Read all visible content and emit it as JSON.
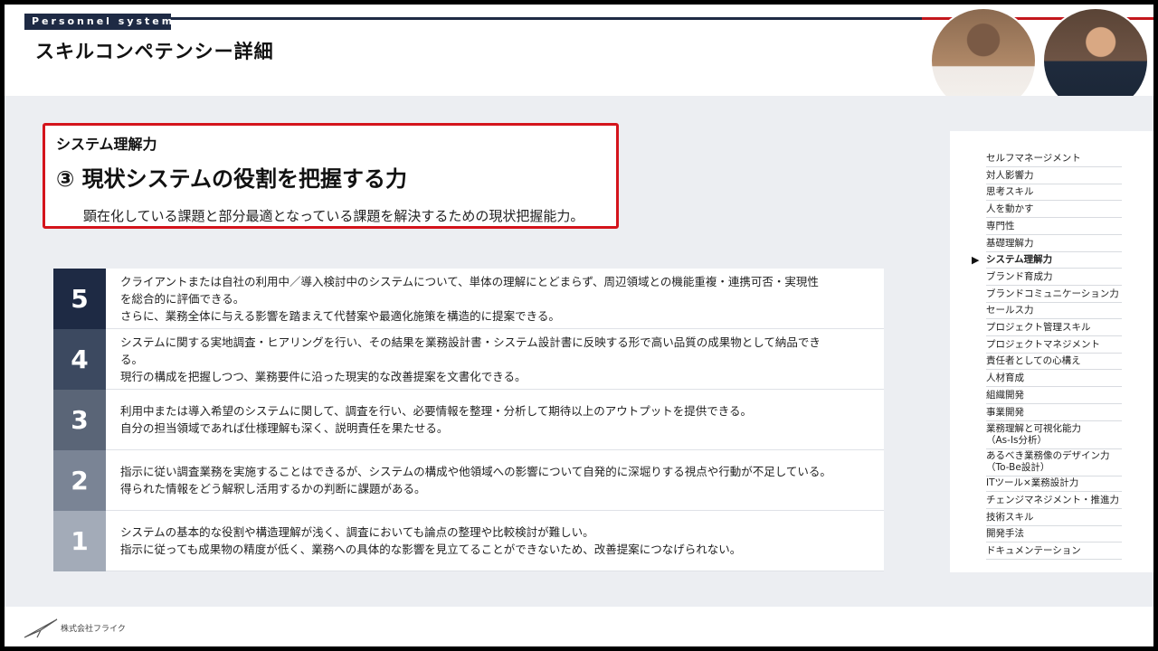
{
  "header": {
    "tag": "Personnel system",
    "title": "スキルコンペテンシー詳細"
  },
  "colors": {
    "navy": "#1e2a44",
    "accent_red": "#d4141c"
  },
  "highlight": {
    "category": "システム理解力",
    "title": "③ 現状システムの役割を把握する力",
    "description": "顕在化している課題と部分最適となっている課題を解決するための現状把握能力。"
  },
  "levels": [
    {
      "num": "5",
      "color": "#1e2a44",
      "lines": [
        "クライアントまたは自社の利用中／導入検討中のシステムについて、単体の理解にとどまらず、周辺領域との機能重複・連携可否・実現性",
        "を総合的に評価できる。",
        "さらに、業務全体に与える影響を踏まえて代替案や最適化施策を構造的に提案できる。"
      ]
    },
    {
      "num": "4",
      "color": "#3c4960",
      "lines": [
        "システムに関する実地調査・ヒアリングを行い、その結果を業務設計書・システム設計書に反映する形で高い品質の成果物として納品でき",
        "る。",
        "現行の構成を把握しつつ、業務要件に沿った現実的な改善提案を文書化できる。"
      ]
    },
    {
      "num": "3",
      "color": "#5a6577",
      "lines": [
        "利用中または導入希望のシステムに関して、調査を行い、必要情報を整理・分析して期待以上のアウトプットを提供できる。",
        "自分の担当領域であれば仕様理解も深く、説明責任を果たせる。"
      ]
    },
    {
      "num": "2",
      "color": "#7a8495",
      "lines": [
        "指示に従い調査業務を実施することはできるが、システムの構成や他領域への影響について自発的に深堀りする視点や行動が不足している。",
        "得られた情報をどう解釈し活用するかの判断に課題がある。"
      ]
    },
    {
      "num": "1",
      "color": "#a3abb8",
      "lines": [
        "システムの基本的な役割や構造理解が浅く、調査においても論点の整理や比較検討が難しい。",
        "指示に従っても成果物の精度が低く、業務への具体的な影響を見立てることができないため、改善提案につなげられない。"
      ]
    }
  ],
  "sidebar": {
    "active_marker": "▶",
    "items": [
      "セルフマネージメント",
      "対人影響力",
      "思考スキル",
      "人を動かす",
      "専門性",
      "基礎理解力",
      "システム理解力",
      "ブランド育成力",
      "ブランドコミュニケーション力",
      "セールス力",
      "プロジェクト管理スキル",
      "プロジェクトマネジメント",
      "責任者としての心構え",
      "人材育成",
      "組織開発",
      "事業開発",
      "業務理解と可視化能力\n（As-Is分析）",
      "あるべき業務像のデザイン力\n（To-Be設計）",
      "ITツール×業務設計力",
      "チェンジマネジメント・推進力",
      "技術スキル",
      "開発手法",
      "ドキュメンテーション"
    ],
    "active_index": 6
  },
  "footer": {
    "company": "株式会社フライク"
  }
}
